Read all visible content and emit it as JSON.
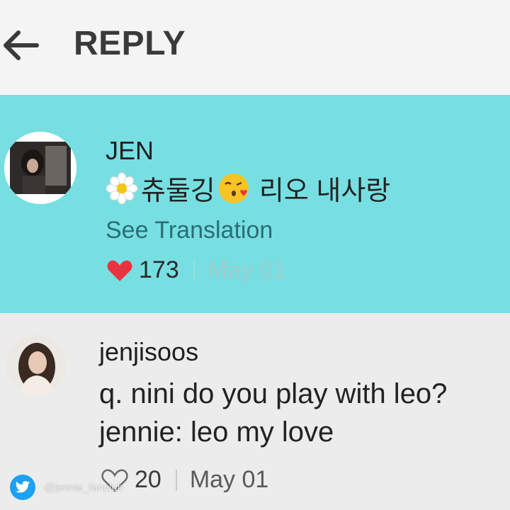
{
  "header": {
    "title": "REPLY",
    "back_icon": "arrow-left-icon"
  },
  "colors": {
    "header_bg": "#f4f4f4",
    "highlight_bg": "#77dfe2",
    "comment_bg": "#ececec",
    "heart_red": "#e8343f",
    "translation_link": "#2b6d73"
  },
  "comments": [
    {
      "username": "JEN",
      "message_emoji_1": "flower-icon",
      "message_part_1": "츄둘깅",
      "message_emoji_2": "kissing-face-icon",
      "message_part_2": "리오 내사랑",
      "see_translation": "See Translation",
      "likes": "173",
      "liked": true,
      "date": "May 01"
    },
    {
      "username": "jenjisoos",
      "message_line_1": "q. nini do you play with leo?",
      "message_line_2": "jennie: leo my love",
      "likes": "20",
      "liked": false,
      "date": "May 01"
    }
  ],
  "watermark": {
    "icon": "twitter-bird-icon",
    "text": "@jennie_fanclub"
  }
}
